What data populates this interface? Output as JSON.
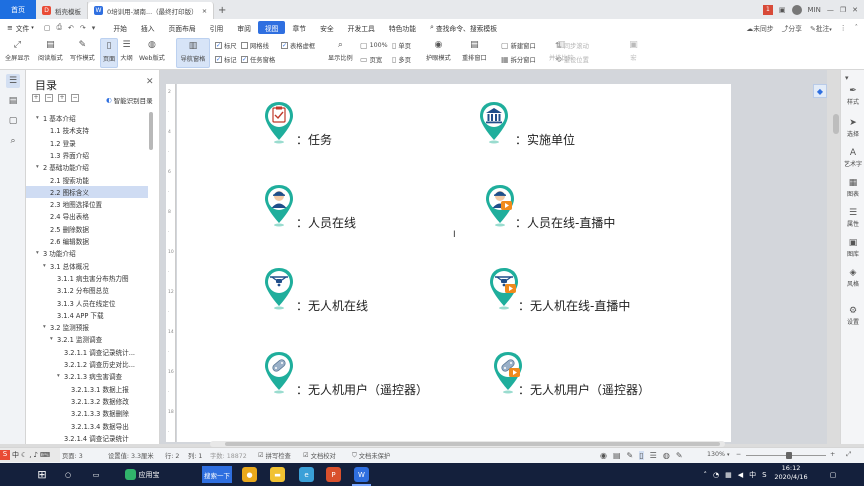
{
  "tabs": {
    "home": "首页",
    "t1": "稻壳模板",
    "t2": "0培训用-湖南...（最终打印版）",
    "counter": "1",
    "user": "MIN"
  },
  "menu": {
    "file": "文件",
    "items": [
      "开始",
      "插入",
      "页面布局",
      "引用",
      "审阅",
      "视图",
      "章节",
      "安全",
      "开发工具",
      "特色功能"
    ],
    "search": "查找命令、搜索模板",
    "sync": "未同步",
    "share": "分享",
    "comment": "批注"
  },
  "ribbon": {
    "fullscreen": "全屏显示",
    "reading": "阅读版式",
    "writing": "写作模式",
    "page": "页面",
    "outline": "大纲",
    "web": "Web版式",
    "nav": "导航窗格",
    "ruler": "标尺",
    "grid": "网格线",
    "table_border": "表格虚框",
    "mark": "标记",
    "task_pane": "任务窗格",
    "display_ratio": "显示比例",
    "zoom100": "100%",
    "page_width": "页宽",
    "single": "单页",
    "multi": "多页",
    "eye": "护眼模式",
    "rearrange": "重排窗口",
    "new_window": "新建窗口",
    "split": "拆分窗口",
    "sync_scroll": "同步滚动",
    "reset_pos": "重设位置",
    "parallel": "并排比较",
    "macro": "宏"
  },
  "toc": {
    "title": "目录",
    "smart": "智能识别目录",
    "items": [
      {
        "t": "1 基本介绍",
        "l": 0,
        "a": "▾"
      },
      {
        "t": "1.1 技术支持",
        "l": 1
      },
      {
        "t": "1.2 登录",
        "l": 1
      },
      {
        "t": "1.3 界面介绍",
        "l": 1
      },
      {
        "t": "2 基础功能介绍",
        "l": 0,
        "a": "▾"
      },
      {
        "t": "2.1 搜索功能",
        "l": 1
      },
      {
        "t": "2.2 图标含义",
        "l": 1,
        "sel": true
      },
      {
        "t": "2.3 地图选择位置",
        "l": 1
      },
      {
        "t": "2.4 导出表格",
        "l": 1
      },
      {
        "t": "2.5 删除数据",
        "l": 1
      },
      {
        "t": "2.6 编辑数据",
        "l": 1
      },
      {
        "t": "3 功能介绍",
        "l": 0,
        "a": "▾"
      },
      {
        "t": "3.1 总体概况",
        "l": 1,
        "a": "▾"
      },
      {
        "t": "3.1.1 病虫害分布热力图",
        "l": 2
      },
      {
        "t": "3.1.2 分布图总览",
        "l": 2
      },
      {
        "t": "3.1.3 人员在线定位",
        "l": 2
      },
      {
        "t": "3.1.4 APP 下载",
        "l": 2
      },
      {
        "t": "3.2 监测预报",
        "l": 1,
        "a": "▾"
      },
      {
        "t": "3.2.1 监测调查",
        "l": 2,
        "a": "▾"
      },
      {
        "t": "3.2.1.1 调查记录统计...",
        "l": 3
      },
      {
        "t": "3.2.1.2 调查历史对比...",
        "l": 3
      },
      {
        "t": "3.2.1.3 病虫害调查",
        "l": 3,
        "a": "▾"
      },
      {
        "t": "3.2.1.3.1 数据上报",
        "l": 4
      },
      {
        "t": "3.2.1.3.2 数据修改",
        "l": 4
      },
      {
        "t": "3.2.1.3.3 数据删除",
        "l": 4
      },
      {
        "t": "3.2.1.3.4 数据导出",
        "l": 4
      },
      {
        "t": "3.2.1.4 调查记录统计",
        "l": 3
      }
    ]
  },
  "icons": [
    {
      "label": "：任务",
      "icon": "clipboard-icon",
      "live": false
    },
    {
      "label": "：实施单位",
      "icon": "building-icon",
      "live": false
    },
    {
      "label": "：人员在线",
      "icon": "person-icon",
      "live": false
    },
    {
      "label": "：人员在线-直播中",
      "icon": "person-icon",
      "live": true
    },
    {
      "label": "：无人机在线",
      "icon": "drone-icon",
      "live": false
    },
    {
      "label": "：无人机在线-直播中",
      "icon": "drone-icon",
      "live": true
    },
    {
      "label": "：无人机用户（遥控器）",
      "icon": "remote-icon",
      "live": false
    },
    {
      "label": "：无人机用户（遥控器）",
      "icon": "remote-icon",
      "live": true
    }
  ],
  "rightpanel": [
    "样式",
    "选择",
    "艺术字",
    "图表",
    "属性",
    "图库",
    "风格",
    "设置"
  ],
  "status": {
    "page": "页面: 3",
    "pos": "设置值: 3.3厘米",
    "row": "行: 2",
    "col": "列: 1",
    "words": "字数: 18872",
    "spell": "拼写检查",
    "proof": "文档校对",
    "protect": "文档未保护",
    "zoom": "130%"
  },
  "taskbar": {
    "search": "搜索一下",
    "app": "应用宝",
    "time": "16:12",
    "date": "2020/4/16",
    "ime": "中"
  },
  "colors": {
    "accent": "#2f6fe0",
    "marker": "#1fae9c",
    "live": "#f08a1c"
  }
}
